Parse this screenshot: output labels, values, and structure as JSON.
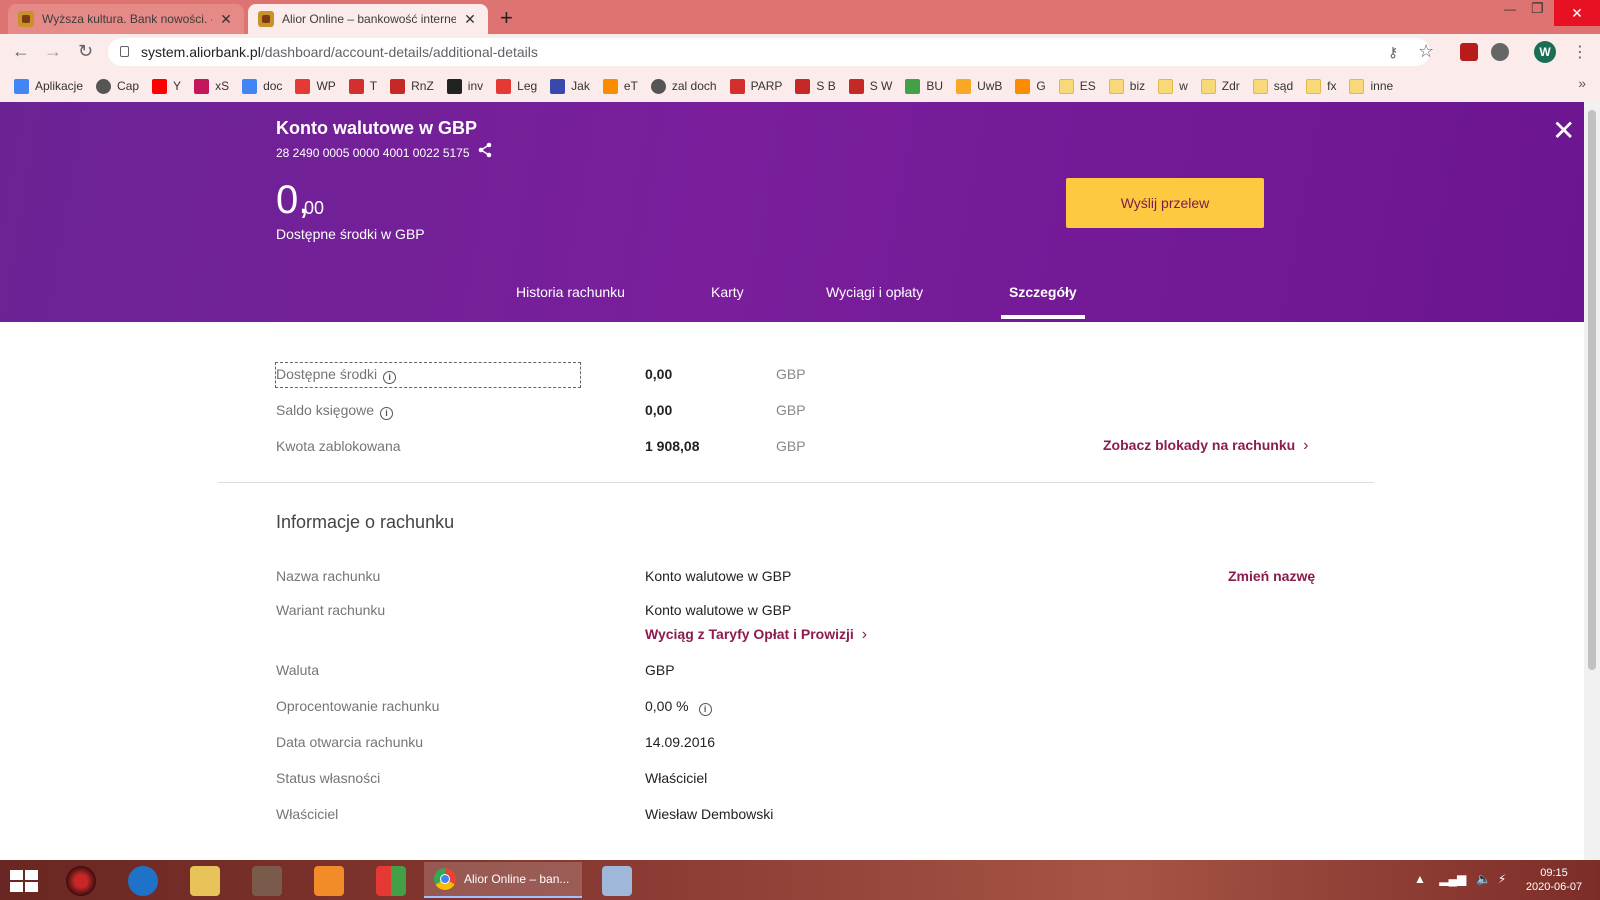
{
  "browser": {
    "tabs": [
      {
        "title": "Wyższa kultura. Bank nowości. - l"
      },
      {
        "title": "Alior Online – bankowość interne"
      }
    ],
    "url_host": "system.aliorbank.pl",
    "url_path": "/dashboard/account-details/additional-details",
    "profile_initial": "W",
    "bookmarks": [
      {
        "label": "Aplikacje",
        "icon": "apps-grid-icon",
        "color": "#4285f4"
      },
      {
        "label": "Cap",
        "icon": "globe-icon",
        "color": "#555555"
      },
      {
        "label": "Y",
        "icon": "youtube-icon",
        "color": "#ff0000"
      },
      {
        "label": "xS",
        "icon": "xs-icon",
        "color": "#c2185b"
      },
      {
        "label": "doc",
        "icon": "docs-icon",
        "color": "#4285f4"
      },
      {
        "label": "WP",
        "icon": "wp-icon",
        "color": "#e53935"
      },
      {
        "label": "T",
        "icon": "t-icon",
        "color": "#d32f2f"
      },
      {
        "label": "RnZ",
        "icon": "rnz-icon",
        "color": "#c62828"
      },
      {
        "label": "inv",
        "icon": "inv-icon",
        "color": "#222222"
      },
      {
        "label": "Leg",
        "icon": "leg-icon",
        "color": "#e53935"
      },
      {
        "label": "Jak",
        "icon": "check-icon",
        "color": "#3949ab"
      },
      {
        "label": "eT",
        "icon": "et-icon",
        "color": "#fb8c00"
      },
      {
        "label": "zal doch",
        "icon": "globe-icon",
        "color": "#555555"
      },
      {
        "label": "PARP",
        "icon": "parp-icon",
        "color": "#d32f2f"
      },
      {
        "label": "S B",
        "icon": "eagle-icon",
        "color": "#c62828"
      },
      {
        "label": "S W",
        "icon": "eagle-icon",
        "color": "#c62828"
      },
      {
        "label": "BU",
        "icon": "puzzle-icon",
        "color": "#43a047"
      },
      {
        "label": "UwB",
        "icon": "u-icon",
        "color": "#f9a825"
      },
      {
        "label": "G",
        "icon": "g-icon",
        "color": "#fb8c00"
      },
      {
        "label": "ES",
        "icon": "folder-icon",
        "color": "#f7d97a"
      },
      {
        "label": "biz",
        "icon": "folder-icon",
        "color": "#f7d97a"
      },
      {
        "label": "w",
        "icon": "folder-icon",
        "color": "#f7d97a"
      },
      {
        "label": "Zdr",
        "icon": "folder-icon",
        "color": "#f7d97a"
      },
      {
        "label": "sąd",
        "icon": "folder-icon",
        "color": "#f7d97a"
      },
      {
        "label": "fx",
        "icon": "folder-icon",
        "color": "#f7d97a"
      },
      {
        "label": "inne",
        "icon": "folder-icon",
        "color": "#f7d97a"
      }
    ]
  },
  "account": {
    "title": "Konto walutowe w GBP",
    "iban": "28 2490 0005 0000 4001 0022 5175",
    "balance_int": "0,",
    "balance_dec": "00",
    "balance_caption": "Dostępne środki w GBP",
    "send_button": "Wyślij przelew"
  },
  "nav_tabs": [
    {
      "label": "Historia rachunku"
    },
    {
      "label": "Karty"
    },
    {
      "label": "Wyciągi i opłaty"
    },
    {
      "label": "Szczegóły",
      "active": true
    }
  ],
  "balances": [
    {
      "label": "Dostępne środki",
      "value": "0,00",
      "currency": "GBP"
    },
    {
      "label": "Saldo księgowe",
      "value": "0,00",
      "currency": "GBP"
    },
    {
      "label": "Kwota zablokowana",
      "value": "1 908,08",
      "currency": "GBP"
    }
  ],
  "blocks_link": "Zobacz blokady na rachunku",
  "info": {
    "title": "Informacje o rachunku",
    "rename_link": "Zmień nazwę",
    "tariff_link": "Wyciąg z Taryfy Opłat i Prowizji",
    "rows": [
      {
        "label": "Nazwa rachunku",
        "value": "Konto walutowe w GBP"
      },
      {
        "label": "Wariant rachunku",
        "value": "Konto walutowe w GBP"
      },
      {
        "label": "Waluta",
        "value": "GBP"
      },
      {
        "label": "Oprocentowanie rachunku",
        "value": "0,00 %"
      },
      {
        "label": "Data otwarcia rachunku",
        "value": "14.09.2016"
      },
      {
        "label": "Status własności",
        "value": "Właściciel"
      },
      {
        "label": "Właściciel",
        "value": "Wiesław Dembowski"
      }
    ]
  },
  "colors": {
    "hero": "#7a1e9c",
    "accent": "#8c1c4f",
    "button": "#fcc940"
  },
  "taskbar": {
    "active_app": "Alior Online – ban...",
    "time": "09:15",
    "date": "2020-06-07"
  }
}
